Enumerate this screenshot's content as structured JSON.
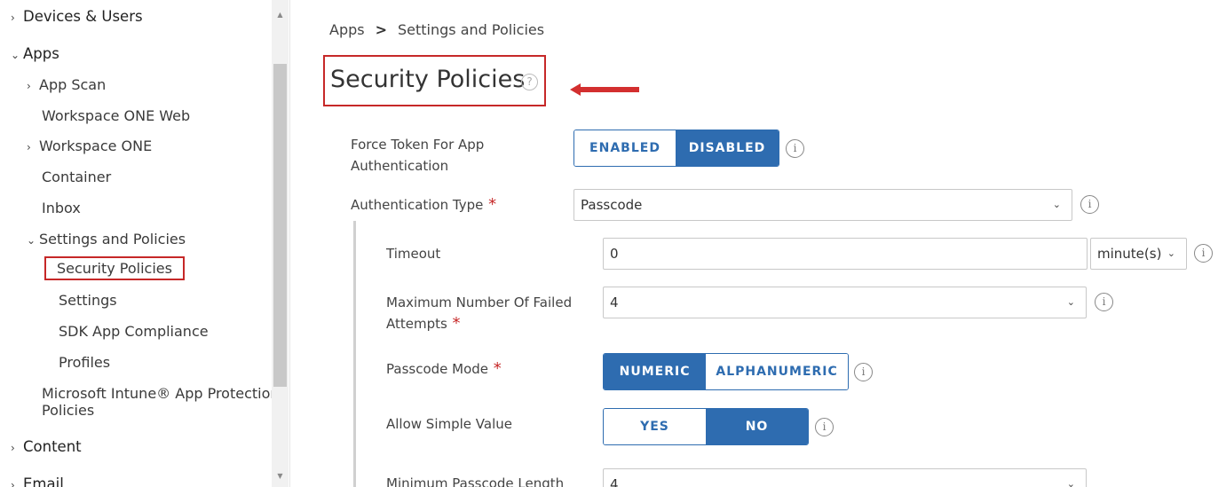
{
  "sidebar": {
    "devices_users": "Devices & Users",
    "apps": "Apps",
    "app_scan": "App Scan",
    "workspace_one_web": "Workspace ONE Web",
    "workspace_one": "Workspace ONE",
    "container": "Container",
    "inbox": "Inbox",
    "settings_and_policies": "Settings and Policies",
    "security_policies": "Security Policies",
    "settings": "Settings",
    "sdk_app_compliance": "SDK App Compliance",
    "profiles": "Profiles",
    "intune": "Microsoft Intune® App Protection Policies",
    "content": "Content",
    "email": "Email"
  },
  "breadcrumb": {
    "apps": "Apps",
    "current": "Settings and Policies"
  },
  "page": {
    "title": "Security Policies"
  },
  "form": {
    "force_token": {
      "label": "Force Token For App Authentication",
      "enabled": "ENABLED",
      "disabled": "DISABLED",
      "selected": "DISABLED"
    },
    "auth_type": {
      "label": "Authentication Type",
      "value": "Passcode"
    },
    "timeout": {
      "label": "Timeout",
      "value": "0",
      "unit": "minute(s)"
    },
    "max_failed": {
      "label": "Maximum Number Of Failed Attempts",
      "value": "4"
    },
    "passcode_mode": {
      "label": "Passcode Mode",
      "numeric": "NUMERIC",
      "alphanumeric": "ALPHANUMERIC",
      "selected": "NUMERIC"
    },
    "simple_value": {
      "label": "Allow Simple Value",
      "yes": "YES",
      "no": "NO",
      "selected": "NO"
    },
    "min_length": {
      "label": "Minimum Passcode Length",
      "value": "4"
    }
  },
  "colors": {
    "accent": "#2e6cb0",
    "highlight": "#c62828"
  }
}
